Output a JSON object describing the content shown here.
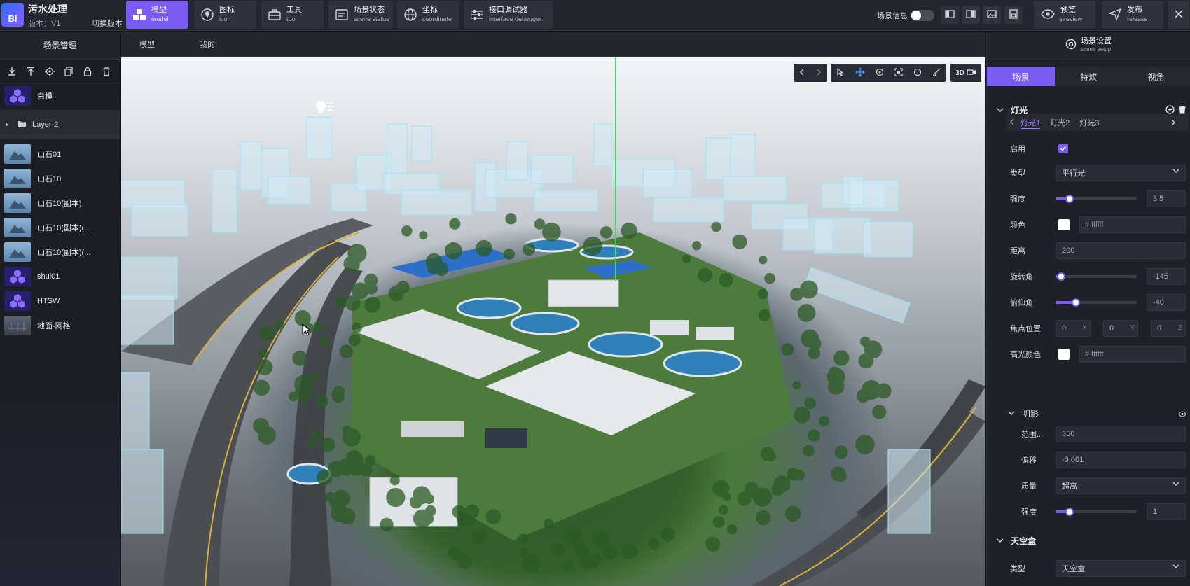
{
  "app": {
    "logo_text": "BI",
    "title": "污水处理",
    "version": "版本：V1",
    "switch_version": "切换版本"
  },
  "toolbar": [
    {
      "zh": "模型",
      "en": "model",
      "icon": "cubes-icon"
    },
    {
      "zh": "图标",
      "en": "icon",
      "icon": "location-pin-icon"
    },
    {
      "zh": "工具",
      "en": "tool",
      "icon": "toolbox-icon"
    },
    {
      "zh": "场景状态",
      "en": "scene status",
      "icon": "scene-status-icon"
    },
    {
      "zh": "坐标",
      "en": "coordinate",
      "icon": "globe-icon"
    },
    {
      "zh": "接口调试器",
      "en": "interface debugger",
      "icon": "sliders-icon"
    }
  ],
  "header_right": {
    "scene_info": "场景信息",
    "preview": {
      "zh": "预览",
      "en": "preview"
    },
    "release": {
      "zh": "发布",
      "en": "release"
    }
  },
  "left_panel": {
    "title": "场景管理",
    "items_top": [
      {
        "label": "白模",
        "thumb": "cube"
      }
    ],
    "layer": "Layer-2",
    "items": [
      {
        "label": "山石01",
        "thumb": "rock"
      },
      {
        "label": "山石10",
        "thumb": "rock"
      },
      {
        "label": "山石10(副本)",
        "thumb": "rock"
      },
      {
        "label": "山石10(副本)(...",
        "thumb": "rock"
      },
      {
        "label": "山石10(副本)(...",
        "thumb": "rock"
      },
      {
        "label": "shui01",
        "thumb": "cube"
      },
      {
        "label": "HTSW",
        "thumb": "cube"
      },
      {
        "label": "地面-网格",
        "thumb": "ground"
      }
    ]
  },
  "sub_tabs": [
    "模型",
    "我的"
  ],
  "viewport": {
    "mode_3d": "3D"
  },
  "right_panel": {
    "title": {
      "zh": "场景设置",
      "en": "scene setup"
    },
    "tabs": [
      "场景",
      "特效",
      "视角"
    ],
    "light_section": "灯光",
    "light_tabs": [
      "灯光1",
      "灯光2",
      "灯光3"
    ],
    "enable_label": "启用",
    "type_label": "类型",
    "type_value": "平行光",
    "intensity_label": "强度",
    "intensity_value": "3.5",
    "intensity_fraction": 0.17,
    "color_label": "颜色",
    "color_hex": "# ffffff",
    "distance_label": "距离",
    "distance_value": "200",
    "rotation_label": "旋转角",
    "rotation_value": "-145",
    "rotation_fraction": 0.07,
    "pitch_label": "俯仰角",
    "pitch_value": "-40",
    "pitch_fraction": 0.25,
    "focus_label": "焦点位置",
    "focus": {
      "x": "0",
      "y": "0",
      "z": "0",
      "xl": "X",
      "yl": "Y",
      "zl": "Z"
    },
    "highlight_label": "高光颜色",
    "highlight_hex": "# ffffff",
    "shadow_section": "阴影",
    "shadow_range_label": "范围...",
    "shadow_range_value": "350",
    "shadow_offset_label": "偏移",
    "shadow_offset_value": "-0.001",
    "shadow_quality_label": "质量",
    "shadow_quality_value": "超高",
    "shadow_intensity_label": "强度",
    "shadow_intensity_value": "1",
    "shadow_intensity_fraction": 0.17,
    "sky_section": "天空盒",
    "sky_type_label": "类型",
    "sky_type_value": "天空盒"
  }
}
